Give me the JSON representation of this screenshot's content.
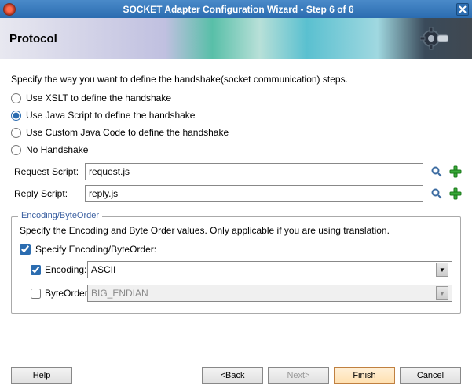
{
  "titlebar": {
    "title": "SOCKET Adapter Configuration Wizard - Step 6 of 6"
  },
  "banner": {
    "heading": "Protocol"
  },
  "instruction": "Specify the way you want to define the handshake(socket communication) steps.",
  "radios": {
    "xslt": "Use XSLT to define the handshake",
    "js": "Use Java Script to define the handshake",
    "custom": "Use Custom Java Code to define the handshake",
    "none": "No Handshake",
    "selected": "js"
  },
  "scripts": {
    "request_label": "Request Script:",
    "request_value": "request.js",
    "reply_label": "Reply Script:",
    "reply_value": "reply.js"
  },
  "encoding": {
    "legend": "Encoding/ByteOrder",
    "desc": "Specify the Encoding and Byte Order values. Only applicable if you are using translation.",
    "specify_label": "Specify Encoding/ByteOrder:",
    "specify_checked": true,
    "encoding_label": "Encoding:",
    "encoding_checked": true,
    "encoding_value": "ASCII",
    "byteorder_label": "ByteOrder:",
    "byteorder_checked": false,
    "byteorder_value": "BIG_ENDIAN"
  },
  "buttons": {
    "help": "Help",
    "back_prefix": "< ",
    "back": "Back",
    "next": "Next",
    "next_suffix": " >",
    "finish": "Finish",
    "cancel": "Cancel"
  }
}
